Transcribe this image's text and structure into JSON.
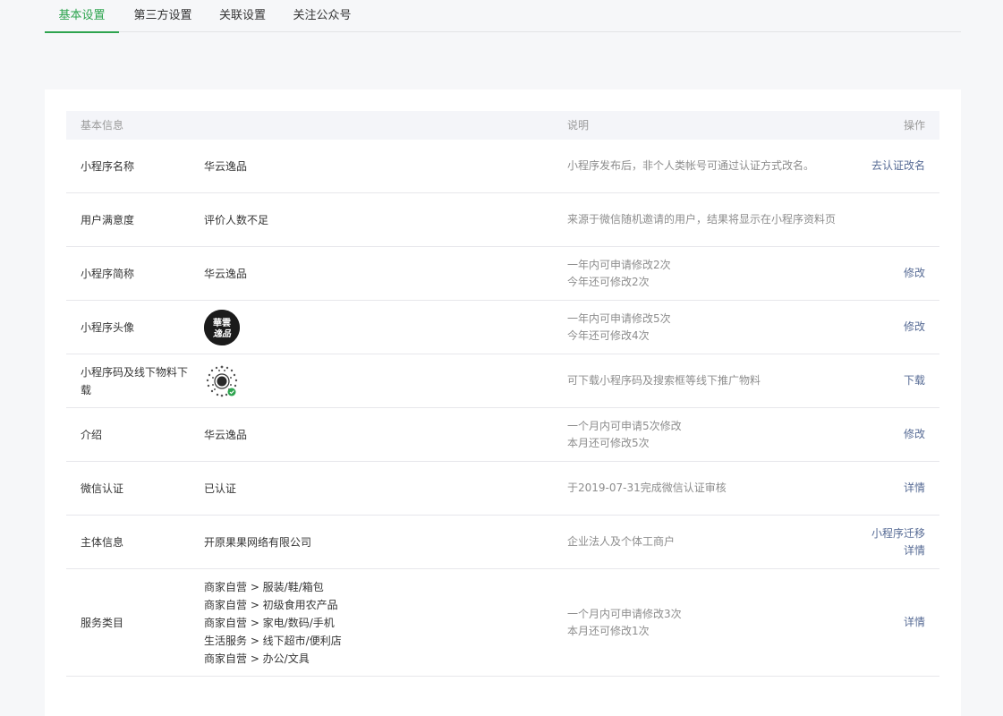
{
  "tabs": [
    {
      "label": "基本设置"
    },
    {
      "label": "第三方设置"
    },
    {
      "label": "关联设置"
    },
    {
      "label": "关注公众号"
    }
  ],
  "table": {
    "header": {
      "col1": "基本信息",
      "col2": "说明",
      "col3": "操作"
    },
    "rows": [
      {
        "label": "小程序名称",
        "value": "华云逸品",
        "desc": [
          "小程序发布后，非个人类帐号可通过认证方式改名。"
        ],
        "ops": [
          "去认证改名"
        ]
      },
      {
        "label": "用户满意度",
        "value": "评价人数不足",
        "desc": [
          "来源于微信随机邀请的用户，结果将显示在小程序资料页"
        ],
        "ops": []
      },
      {
        "label": "小程序简称",
        "value": "华云逸品",
        "desc": [
          "一年内可申请修改2次",
          "今年还可修改2次"
        ],
        "ops": [
          "修改"
        ]
      },
      {
        "label": "小程序头像",
        "desc": [
          "一年内可申请修改5次",
          "今年还可修改4次"
        ],
        "ops": [
          "修改"
        ]
      },
      {
        "label": "小程序码及线下物料下载",
        "desc": [
          "可下载小程序码及搜索框等线下推广物料"
        ],
        "ops": [
          "下载"
        ]
      },
      {
        "label": "介绍",
        "value": "华云逸品",
        "desc": [
          "一个月内可申请5次修改",
          "本月还可修改5次"
        ],
        "ops": [
          "修改"
        ]
      },
      {
        "label": "微信认证",
        "value": "已认证",
        "desc": [
          "于2019-07-31完成微信认证审核"
        ],
        "ops": [
          "详情"
        ]
      },
      {
        "label": "主体信息",
        "value": "开原果果网络有限公司",
        "desc": [
          "企业法人及个体工商户"
        ],
        "ops": [
          "小程序迁移",
          "详情"
        ]
      },
      {
        "label": "服务类目",
        "values": [
          "商家自营 > 服装/鞋/箱包",
          "商家自营 > 初级食用农产品",
          "商家自营 > 家电/数码/手机",
          "生活服务 > 线下超市/便利店",
          "商家自营 > 办公/文具"
        ],
        "desc": [
          "一个月内可申请修改3次",
          "本月还可修改1次"
        ],
        "ops": [
          "详情"
        ]
      }
    ]
  },
  "avatar": {
    "text_line1": "華雲",
    "text_line2": "逸品"
  },
  "colors": {
    "accent": "#2ea44f",
    "link": "#576b95",
    "muted": "#8d8d8d",
    "text": "#353535"
  }
}
